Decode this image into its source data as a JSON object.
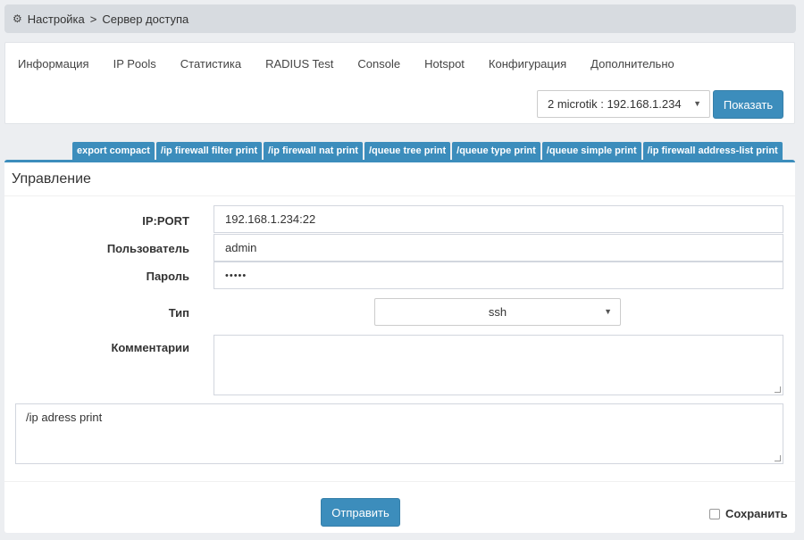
{
  "breadcrumb": {
    "icon": "gear-icon",
    "items": [
      "Настройка",
      ">",
      "Сервер доступа"
    ]
  },
  "tabs": [
    {
      "label": "Информация"
    },
    {
      "label": "IP Pools"
    },
    {
      "label": "Статистика"
    },
    {
      "label": "RADIUS Test"
    },
    {
      "label": "Console"
    },
    {
      "label": "Hotspot"
    },
    {
      "label": "Конфигурация"
    },
    {
      "label": "Дополнительно"
    }
  ],
  "server_select": {
    "value": "2 microtik : 192.168.1.234"
  },
  "show_button": {
    "label": "Показать"
  },
  "commands": [
    "export compact",
    "/ip firewall filter print",
    "/ip firewall nat print",
    "/queue tree print",
    "/queue type print",
    "/queue simple print",
    "/ip firewall address-list print"
  ],
  "panel": {
    "title": "Управление",
    "fields": {
      "ip_port": {
        "label": "IP:PORT",
        "value": "192.168.1.234:22"
      },
      "user": {
        "label": "Пользователь",
        "value": "admin"
      },
      "password": {
        "label": "Пароль",
        "value": "•••••"
      },
      "type": {
        "label": "Тип",
        "value": "ssh"
      },
      "comment": {
        "label": "Комментарии",
        "value": ""
      },
      "command": {
        "value": "/ip adress print"
      }
    },
    "send_button": {
      "label": "Отправить"
    },
    "save_checkbox": {
      "label": "Сохранить",
      "checked": false
    }
  },
  "colors": {
    "accent": "#3c8dbc",
    "background": "#eceef1"
  }
}
